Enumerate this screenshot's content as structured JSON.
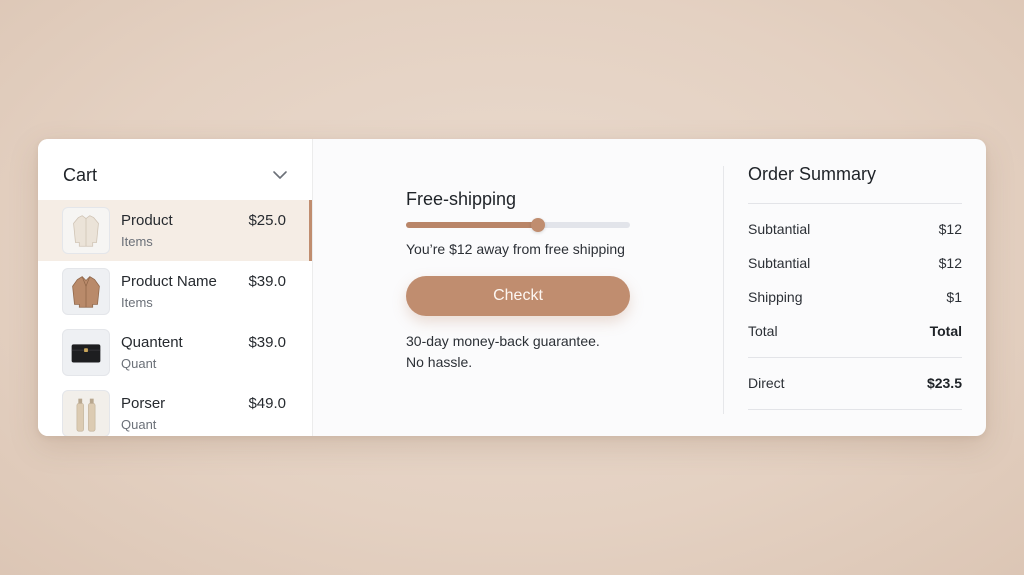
{
  "cart": {
    "title": "Cart",
    "collapse_icon": "chevron-down-icon",
    "items": [
      {
        "name": "Product",
        "subtitle": "Items",
        "price": "$25.0",
        "thumbnail": "jacket-image",
        "active": true
      },
      {
        "name": "Product Name",
        "subtitle": "Items",
        "price": "$39.0",
        "thumbnail": "coat-image",
        "active": false
      },
      {
        "name": "Quantent",
        "subtitle": "Quant",
        "price": "$39.0",
        "thumbnail": "wallet-image",
        "active": false
      },
      {
        "name": "Porser",
        "subtitle": "Quant",
        "price": "$49.0",
        "thumbnail": "bottles-image",
        "active": false
      }
    ]
  },
  "shipping": {
    "title": "Free-shipping",
    "progress": 0.59,
    "message": "You’re $12 away from free shipping",
    "checkout_label": "Checkt",
    "guarantee_line1": "30-day money-back guarantee.",
    "guarantee_line2": "No hassle."
  },
  "summary": {
    "title": "Order Summary",
    "rows": [
      {
        "label": "Subtantial",
        "value": "$12"
      },
      {
        "label": "Subtantial",
        "value": "$12"
      },
      {
        "label": "Shipping",
        "value": "$1"
      },
      {
        "label": "Total",
        "value": "Total"
      }
    ],
    "direct": {
      "label": "Direct",
      "value": "$23.5"
    }
  },
  "colors": {
    "accent": "#c08d6f",
    "background": "#e6d5c7",
    "active_row": "#f5ede5"
  }
}
